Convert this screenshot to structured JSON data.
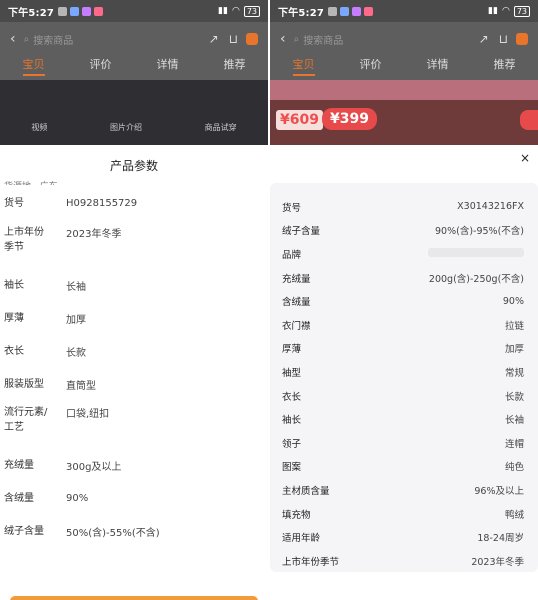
{
  "status_bar": {
    "time": "下午5:27",
    "battery": "73"
  },
  "nav": {
    "search_placeholder": "搜索商品",
    "tabs": [
      "宝贝",
      "评价",
      "详情",
      "推荐"
    ]
  },
  "left_bg": {
    "image_tabs": [
      "视频",
      "图片介绍",
      "商品试穿"
    ]
  },
  "right_bg": {
    "price": "¥609",
    "promo_price": "¥399"
  },
  "left_sheet": {
    "title": "产品参数",
    "cut_row": "货源地 · 广东",
    "rows": [
      {
        "label": "货号",
        "value": "H0928155729"
      },
      {
        "label": "上市年份季节",
        "value": "2023年冬季"
      },
      {
        "label": "袖长",
        "value": "长袖"
      },
      {
        "label": "厚薄",
        "value": "加厚"
      },
      {
        "label": "衣长",
        "value": "长款"
      },
      {
        "label": "服装版型",
        "value": "直筒型"
      },
      {
        "label": "流行元素/工艺",
        "value": "口袋,纽扣"
      },
      {
        "label": "充绒量",
        "value": "300g及以上"
      },
      {
        "label": "含绒量",
        "value": "90%"
      },
      {
        "label": "绒子含量",
        "value": "50%(含)-55%(不含)"
      }
    ]
  },
  "right_sheet": {
    "close": "×",
    "rows": [
      {
        "label": "货号",
        "value": "X30143216FX"
      },
      {
        "label": "绒子含量",
        "value": "90%(含)-95%(不含)"
      },
      {
        "label": "品牌",
        "value": ""
      },
      {
        "label": "充绒量",
        "value": "200g(含)-250g(不含)"
      },
      {
        "label": "含绒量",
        "value": "90%"
      },
      {
        "label": "衣门襟",
        "value": "拉链"
      },
      {
        "label": "厚薄",
        "value": "加厚"
      },
      {
        "label": "袖型",
        "value": "常规"
      },
      {
        "label": "衣长",
        "value": "长款"
      },
      {
        "label": "袖长",
        "value": "长袖"
      },
      {
        "label": "领子",
        "value": "连帽"
      },
      {
        "label": "图案",
        "value": "纯色"
      },
      {
        "label": "主材质含量",
        "value": "96%及以上"
      },
      {
        "label": "填充物",
        "value": "鸭绒"
      },
      {
        "label": "适用年龄",
        "value": "18-24周岁"
      },
      {
        "label": "上市年份季节",
        "value": "2023年冬季"
      }
    ]
  }
}
